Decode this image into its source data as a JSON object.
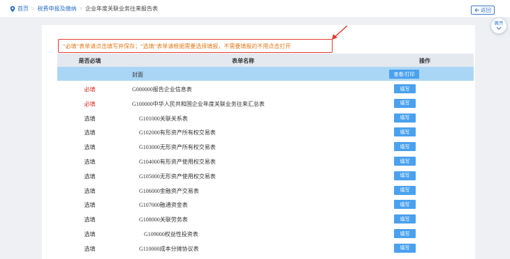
{
  "breadcrumb": {
    "home": "首页",
    "level2": "税费申报及缴纳",
    "current": "企业年度关联业务往来报告表"
  },
  "back_label": "返回",
  "expand_label": "展开",
  "notice": "“必填”表单请点击填写并保存；“选填”表单请根据需要选择填报，不需要填报的不用点击打开",
  "table": {
    "headers": {
      "required": "是否必填",
      "name": "表单名称",
      "operation": "操作"
    },
    "cover": {
      "name": "封面",
      "button": "查看/打印"
    },
    "rows": [
      {
        "req": "必填",
        "name": "G000000报告企业信息表",
        "button": "填写"
      },
      {
        "req": "必填",
        "name": "G100000中华人民共和国企业年度关联业务往来汇总表",
        "button": "填写"
      },
      {
        "req": "选填",
        "name": "G101000关联关系表",
        "button": "填写"
      },
      {
        "req": "选填",
        "name": "G102000有形资产所有权交易表",
        "button": "填写"
      },
      {
        "req": "选填",
        "name": "G103000无形资产所有权交易表",
        "button": "填写"
      },
      {
        "req": "选填",
        "name": "G104000有形资产使用权交易表",
        "button": "填写"
      },
      {
        "req": "选填",
        "name": "G105000无形资产使用权交易表",
        "button": "填写"
      },
      {
        "req": "选填",
        "name": "G106000金融资产交易表",
        "button": "填写"
      },
      {
        "req": "选填",
        "name": "G107000融通资金表",
        "button": "填写"
      },
      {
        "req": "选填",
        "name": "G108000关联劳务表",
        "button": "填写"
      },
      {
        "req": "选填",
        "name": "G109000权益性投资表",
        "button": "填写"
      },
      {
        "req": "选填",
        "name": "G110000成本分摊协议表",
        "button": "填写"
      }
    ]
  },
  "colors": {
    "required_red": "#e0291c",
    "button_blue": "#4aa1ee",
    "notice_border": "#e03a2c"
  },
  "icons": [
    "location-pin-icon",
    "back-arrow-icon",
    "chevron-down-icon",
    "annotation-arrow-icon"
  ]
}
